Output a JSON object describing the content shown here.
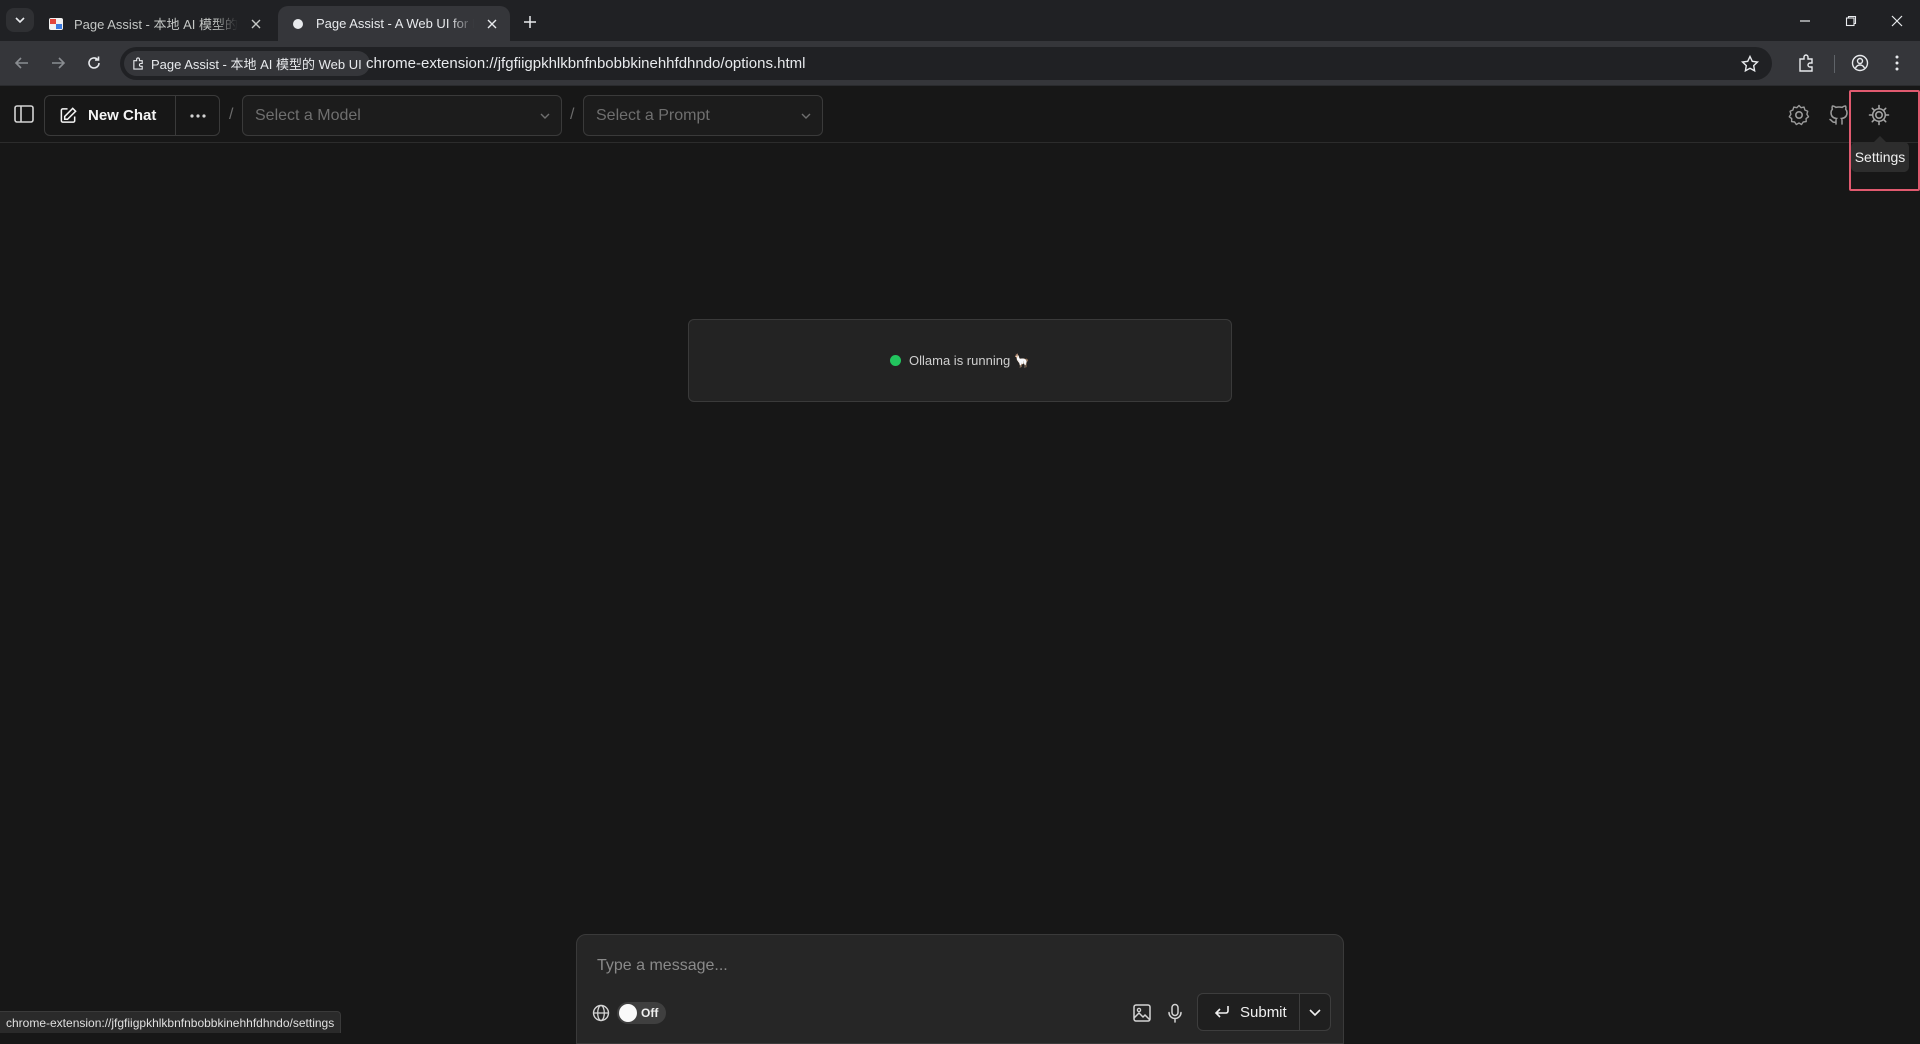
{
  "browser": {
    "tabs": [
      {
        "label": "Page Assist - 本地 AI 模型的 Web UI",
        "active": false
      },
      {
        "label": "Page Assist - A Web UI for Local AI Models",
        "active": true
      }
    ],
    "site_chip": "Page Assist - 本地 AI 模型的 Web UI",
    "url": "chrome-extension://jfgfiigpkhlkbnfnbobbkinehhfdhndo/options.html",
    "status_url": "chrome-extension://jfgfiigpkhlkbnfnbobbkinehhfdhndo/settings"
  },
  "header": {
    "new_chat_label": "New Chat",
    "separator": "/",
    "model_select_placeholder": "Select a Model",
    "prompt_select_placeholder": "Select a Prompt",
    "tooltip": "Settings"
  },
  "status": {
    "text": "Ollama is running 🦙",
    "dot_color": "#22c55e"
  },
  "composer": {
    "placeholder": "Type a message...",
    "web_search_toggle": "Off",
    "submit_label": "Submit"
  },
  "colors": {
    "background": "#171717",
    "highlight": "#e05a6f"
  }
}
